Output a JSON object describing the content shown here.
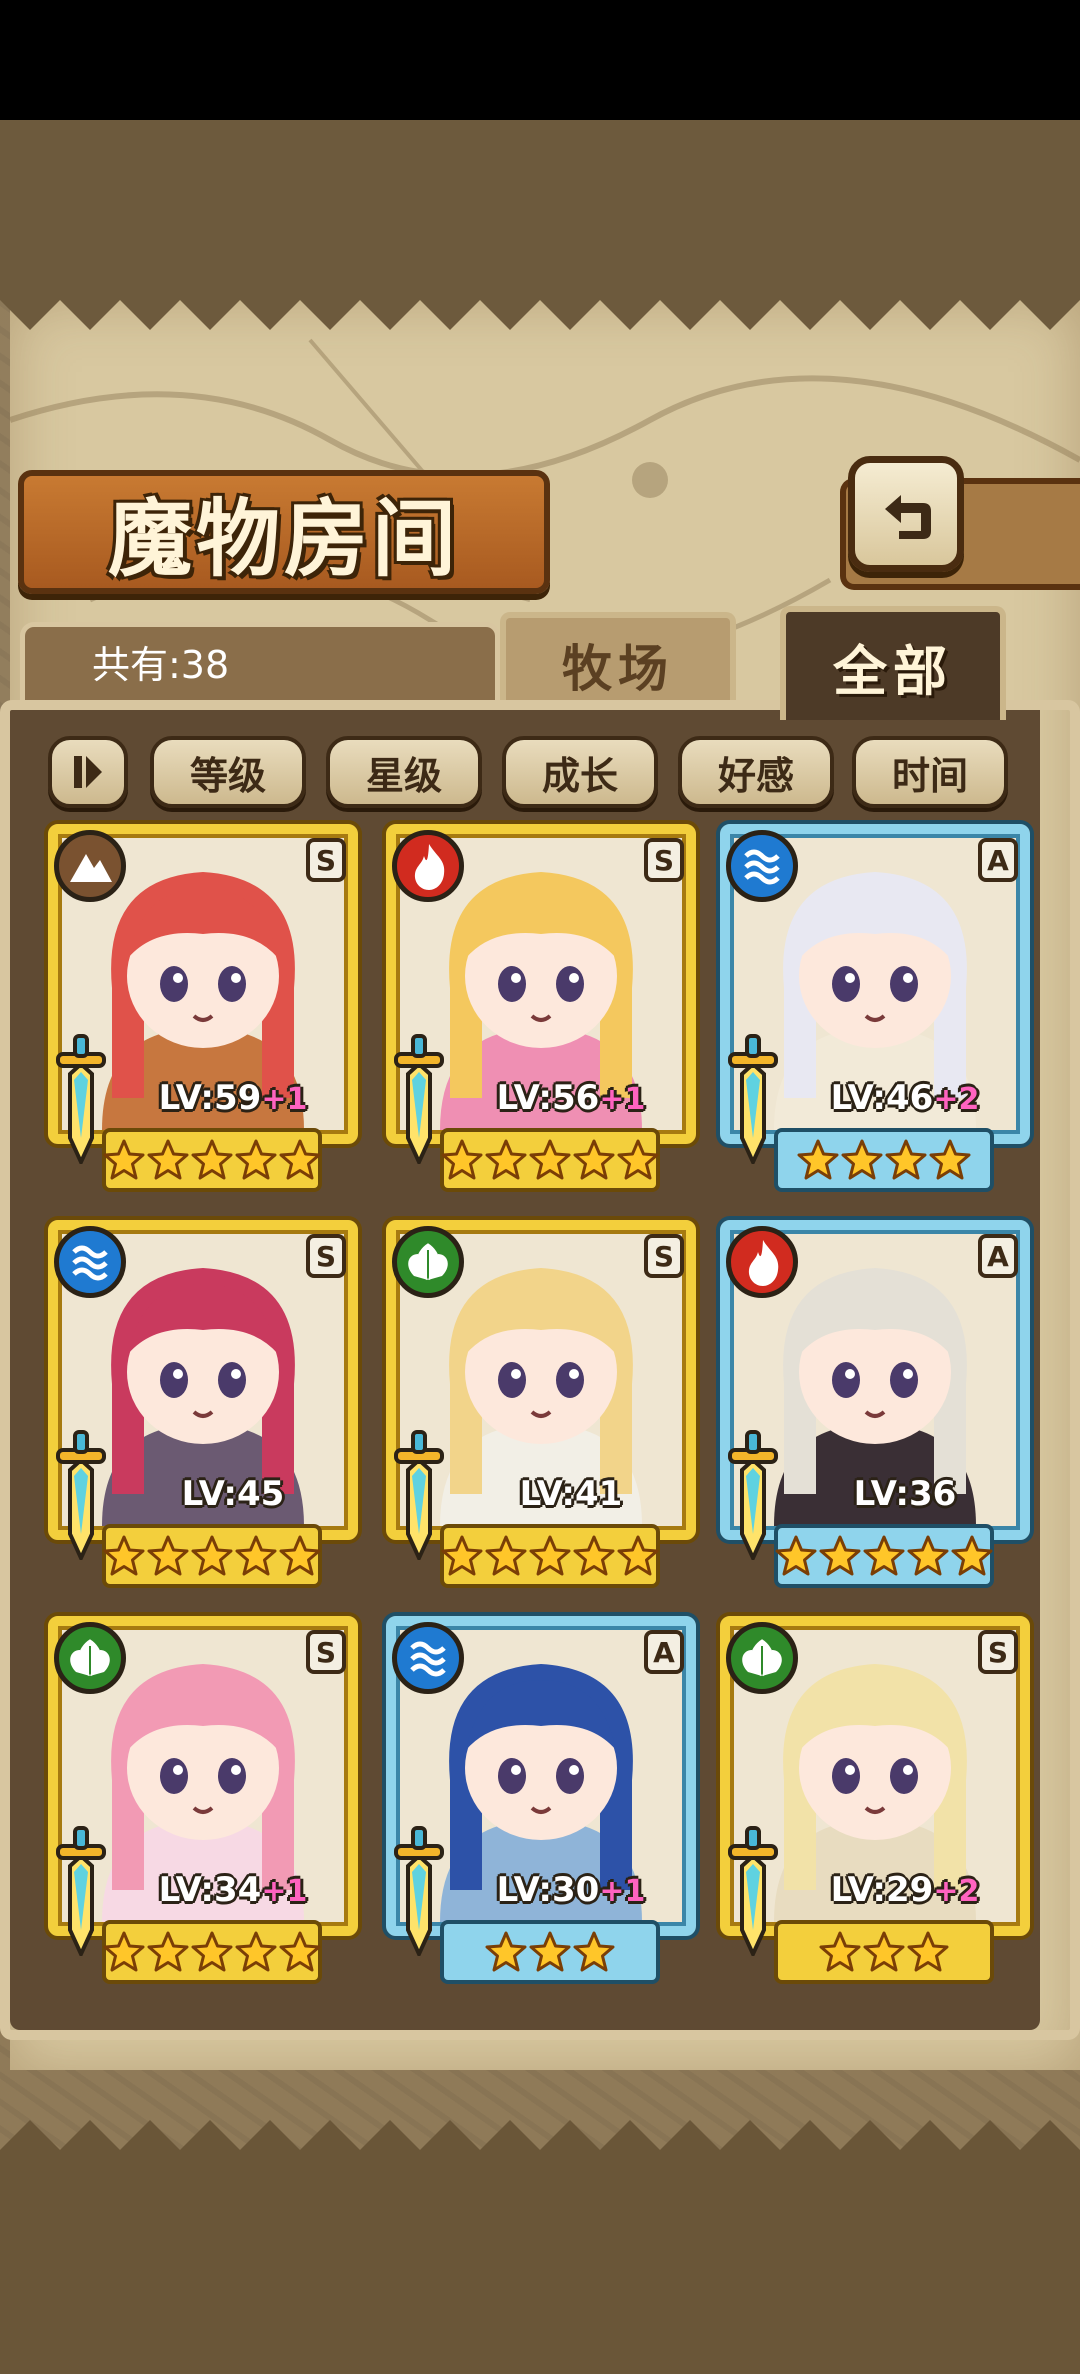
{
  "header": {
    "title": "魔物房间"
  },
  "tabs": {
    "farm_label": "牧场",
    "all_label": "全部"
  },
  "count_text": "共有:38",
  "sort_buttons": [
    {
      "label": "等级"
    },
    {
      "label": "星级"
    },
    {
      "label": "成长"
    },
    {
      "label": "好感"
    },
    {
      "label": "时间"
    }
  ],
  "colors": {
    "fire": "#d12b1f",
    "water": "#1f7ad1",
    "leaf": "#2f8a2a",
    "earth": "#7a5230",
    "rank_s_frame": "#f3cf3c",
    "rank_a_frame": "#8fd4ec",
    "bonus": "#ff63c0"
  },
  "cards": [
    {
      "rank": "S",
      "element": "earth-icon",
      "level": "LV:59",
      "bonus": "+1",
      "stars": 5,
      "hair": "#e0524a",
      "cloth": "#c7773f"
    },
    {
      "rank": "S",
      "element": "fire-icon",
      "level": "LV:56",
      "bonus": "+1",
      "stars": 5,
      "hair": "#f4c85e",
      "cloth": "#ef8fb3"
    },
    {
      "rank": "A",
      "element": "water-icon",
      "level": "LV:46",
      "bonus": "+2",
      "stars": 4,
      "hair": "#e8e8f2",
      "cloth": "#f2ead8"
    },
    {
      "rank": "S",
      "element": "water-icon",
      "level": "LV:45",
      "bonus": "",
      "stars": 5,
      "hair": "#c93a5e",
      "cloth": "#6b5a72"
    },
    {
      "rank": "S",
      "element": "leaf-icon",
      "level": "LV:41",
      "bonus": "",
      "stars": 5,
      "hair": "#f2d48a",
      "cloth": "#f2efe6"
    },
    {
      "rank": "A",
      "element": "fire-icon",
      "level": "LV:36",
      "bonus": "",
      "stars": 5,
      "hair": "#e4e0d6",
      "cloth": "#3a2f35"
    },
    {
      "rank": "S",
      "element": "leaf-icon",
      "level": "LV:34",
      "bonus": "+1",
      "stars": 5,
      "hair": "#f29ab4",
      "cloth": "#f7d9e4"
    },
    {
      "rank": "A",
      "element": "water-icon",
      "level": "LV:30",
      "bonus": "+1",
      "stars": 3,
      "hair": "#2d52a8",
      "cloth": "#8fb4d8"
    },
    {
      "rank": "S",
      "element": "leaf-icon",
      "level": "LV:29",
      "bonus": "+2",
      "stars": 3,
      "hair": "#f2e2a8",
      "cloth": "#e8dcc0"
    }
  ]
}
